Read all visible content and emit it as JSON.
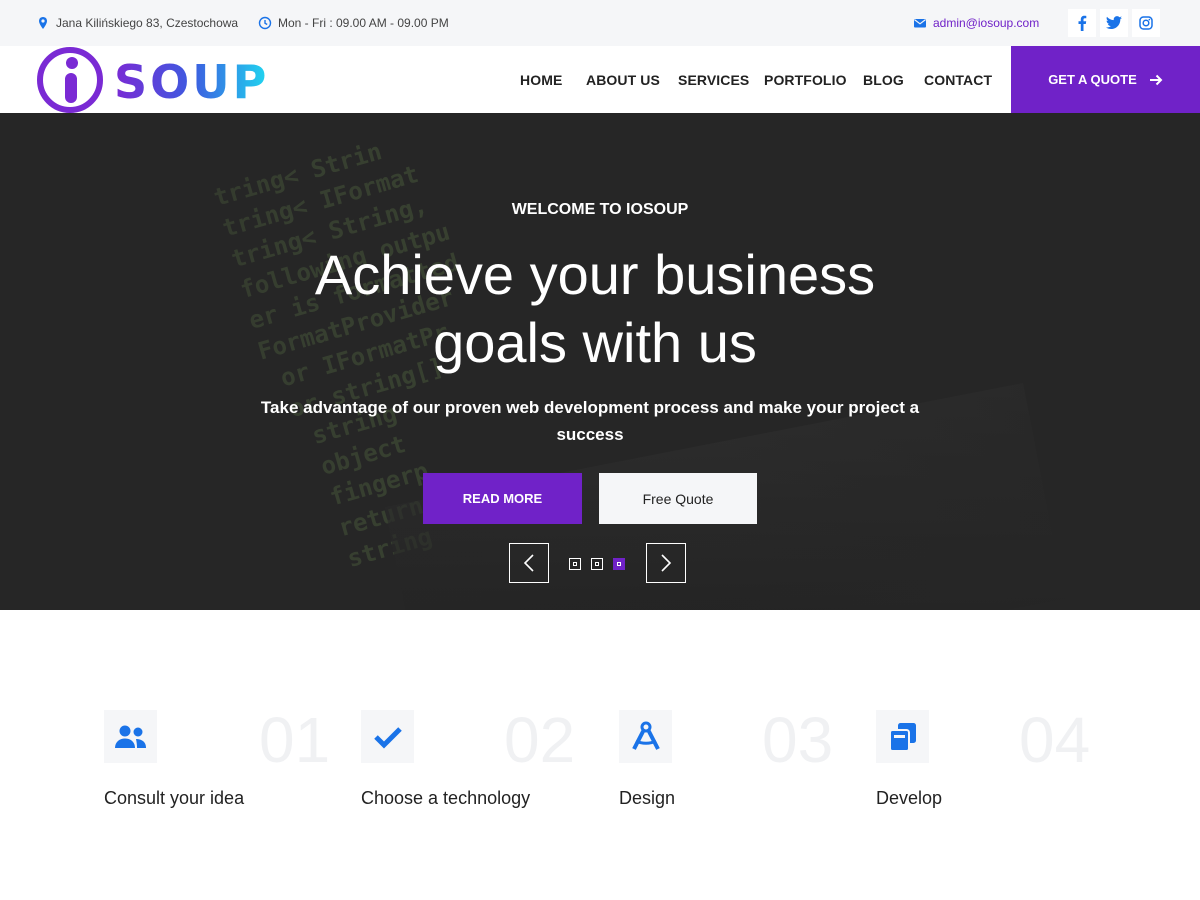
{
  "topbar": {
    "address": "Jana Kilińskiego 83, Czestochowa",
    "hours": "Mon - Fri : 09.00 AM - 09.00 PM",
    "email": "admin@iosoup.com",
    "social": [
      "facebook-icon",
      "twitter-icon",
      "instagram-icon"
    ]
  },
  "brand": {
    "logo_text": "iosoup",
    "colors": {
      "accent": "#7022c8",
      "blue": "#1a73e8",
      "cyan": "#22b8e6"
    }
  },
  "nav": {
    "items": [
      "HOME",
      "ABOUT US",
      "SERVICES",
      "PORTFOLIO",
      "BLOG",
      "CONTACT"
    ],
    "cta": "GET A QUOTE"
  },
  "hero": {
    "welcome": "WELCOME TO IOSOUP",
    "title": "Achieve your business goals with us",
    "subtitle": "Take advantage of our proven web development process and make your project a success",
    "read_more": "READ MORE",
    "free_quote": "Free Quote",
    "slides": {
      "count": 3,
      "active": 3
    }
  },
  "features": [
    {
      "number": "01",
      "title": "Consult your idea",
      "icon": "users-icon"
    },
    {
      "number": "02",
      "title": "Choose a technology",
      "icon": "check-icon"
    },
    {
      "number": "03",
      "title": "Design",
      "icon": "drafting-compass-icon"
    },
    {
      "number": "04",
      "title": "Develop",
      "icon": "clone-icon"
    }
  ]
}
